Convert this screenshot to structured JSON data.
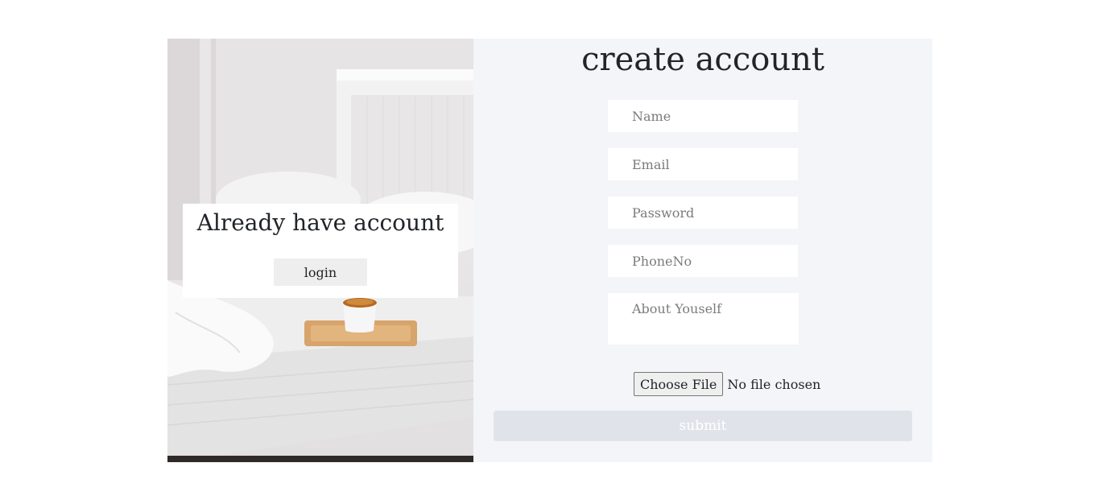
{
  "login_panel": {
    "title": "Already have account",
    "login_label": "login"
  },
  "signup_form": {
    "title": "create account",
    "name_placeholder": "Name",
    "email_placeholder": "Email",
    "password_placeholder": "Password",
    "phone_placeholder": "PhoneNo",
    "about_placeholder": "About Youself",
    "file_button_label": "Choose File",
    "file_status": "No file chosen",
    "submit_label": "submit"
  },
  "colors": {
    "form_background": "#f4f5f8",
    "submit_background": "#e0e4ea",
    "login_button_background": "#eeeeee"
  }
}
